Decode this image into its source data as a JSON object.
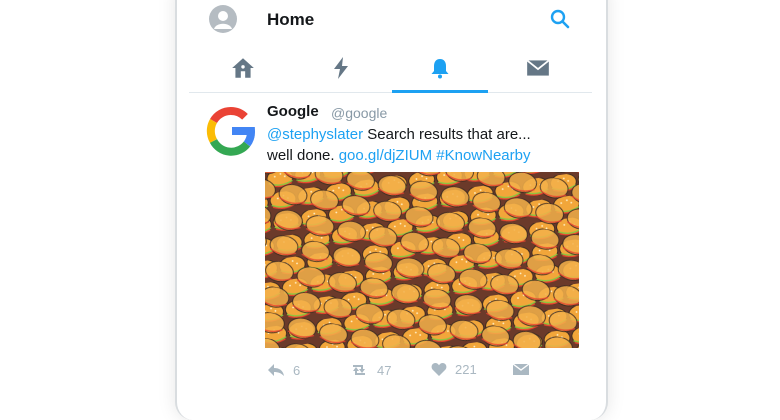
{
  "header": {
    "title": "Home"
  },
  "tabs": [
    {
      "name": "home",
      "active": false
    },
    {
      "name": "moments",
      "active": false
    },
    {
      "name": "notifications",
      "active": true
    },
    {
      "name": "messages",
      "active": false
    }
  ],
  "tweet": {
    "author": "Google",
    "handle": "@google",
    "mention": "@stephyslater",
    "text_line1": " Search results that are...",
    "text_line2": "well done. ",
    "link": "goo.gl/djZIUM",
    "hashtag": "#KnowNearby",
    "replies": "6",
    "retweets": "47",
    "likes": "221"
  },
  "colors": {
    "accent": "#1da1f2",
    "icon_gray": "#657786",
    "muted": "#aab8c2"
  }
}
